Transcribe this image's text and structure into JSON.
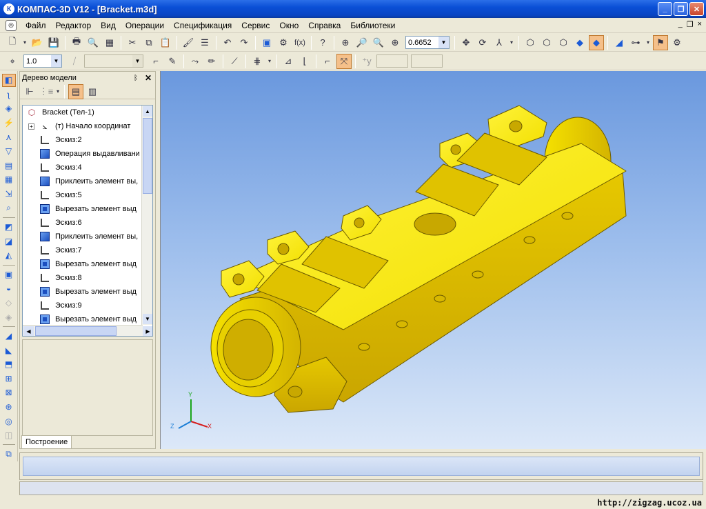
{
  "window": {
    "title": "КОМПАС-3D V12 - [Bracket.m3d]",
    "app_icon": "К",
    "controls": {
      "minimize": "_",
      "maximize": "❐",
      "close": "✕"
    }
  },
  "menu": {
    "items": [
      "Файл",
      "Редактор",
      "Вид",
      "Операции",
      "Спецификация",
      "Сервис",
      "Окно",
      "Справка",
      "Библиотеки"
    ],
    "mdi": {
      "minimize": "_",
      "restore": "❐",
      "close": "×"
    }
  },
  "toolbar1": {
    "zoom_value": "0.6652"
  },
  "toolbar2": {
    "step_value": "1.0"
  },
  "model_tree": {
    "title": "Дерево модели",
    "pin": "ᛒ",
    "close": "✕",
    "items": [
      {
        "label": "Bracket (Тел-1)",
        "type": "root"
      },
      {
        "label": "(т) Начало координат",
        "type": "origin"
      },
      {
        "label": "Эскиз:2",
        "type": "sketch"
      },
      {
        "label": "Операция выдавливани",
        "type": "extrude"
      },
      {
        "label": "Эскиз:4",
        "type": "sketch"
      },
      {
        "label": "Приклеить элемент вы,",
        "type": "extrude"
      },
      {
        "label": "Эскиз:5",
        "type": "sketch"
      },
      {
        "label": "Вырезать элемент выд",
        "type": "cut"
      },
      {
        "label": "Эскиз:6",
        "type": "sketch"
      },
      {
        "label": "Приклеить элемент вы,",
        "type": "extrude"
      },
      {
        "label": "Эскиз:7",
        "type": "sketch"
      },
      {
        "label": "Вырезать элемент выд",
        "type": "cut"
      },
      {
        "label": "Эскиз:8",
        "type": "sketch"
      },
      {
        "label": "Вырезать элемент выд",
        "type": "cut"
      },
      {
        "label": "Эскиз:9",
        "type": "sketch"
      },
      {
        "label": "Вырезать элемент выд",
        "type": "cut"
      }
    ],
    "tab_label": "Построение"
  },
  "viewport": {
    "axes": {
      "x": "X",
      "y": "Y",
      "z": "Z"
    },
    "part_color": "#f5e400"
  },
  "footer": {
    "url": "http://zigzag.ucoz.ua"
  }
}
